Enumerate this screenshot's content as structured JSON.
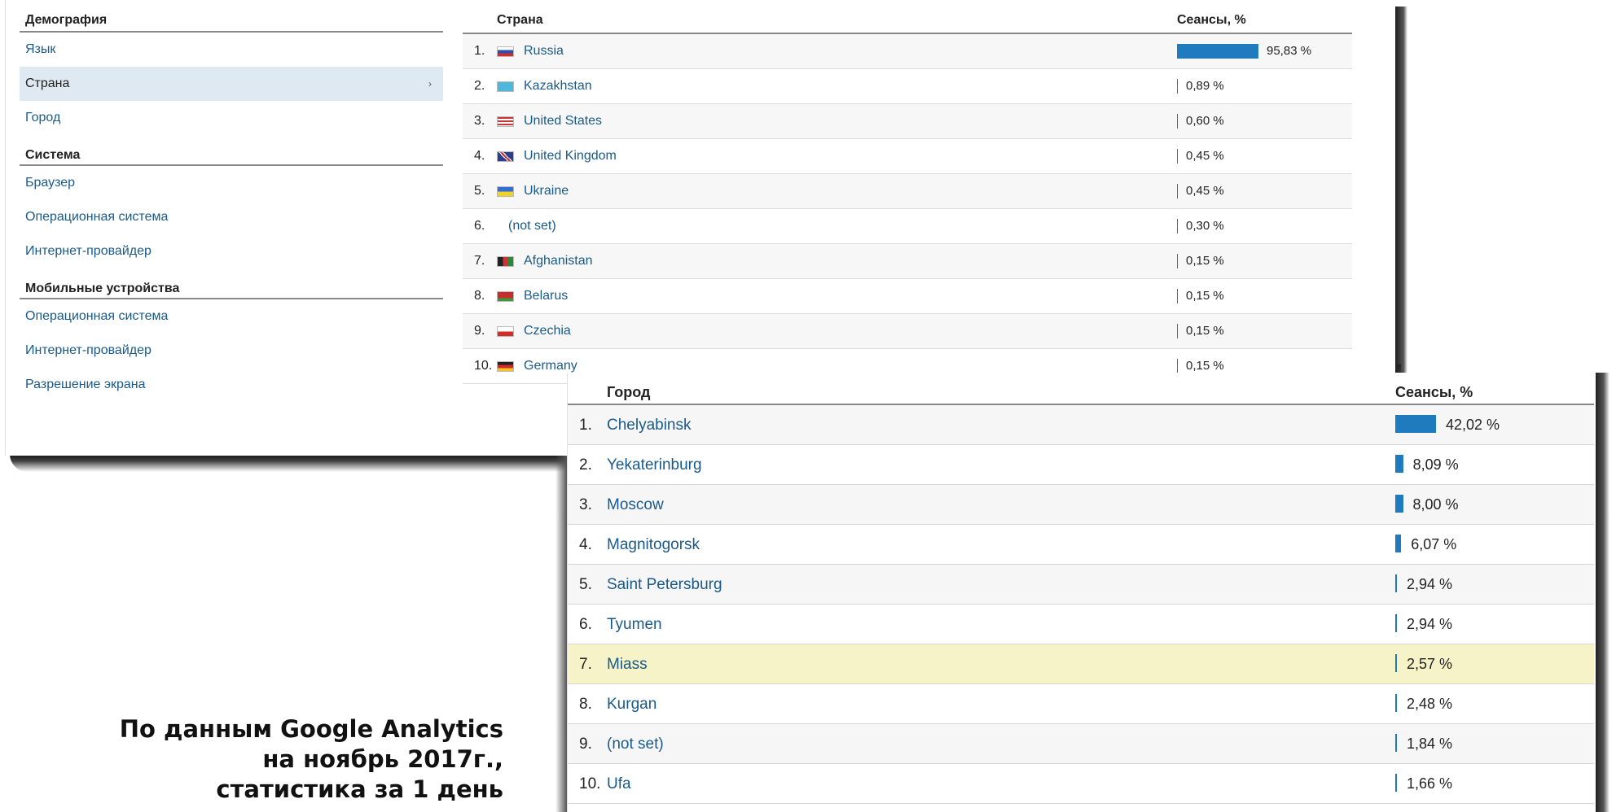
{
  "sidebar": {
    "sections": [
      {
        "title": "Демография",
        "items": [
          "Язык",
          "Страна",
          "Город"
        ],
        "active": 1
      },
      {
        "title": "Система",
        "items": [
          "Браузер",
          "Операционная система",
          "Интернет-провайдер"
        ]
      },
      {
        "title": "Мобильные устройства",
        "items": [
          "Операционная система",
          "Интернет-провайдер",
          "Разрешение экрана"
        ]
      }
    ]
  },
  "country_table": {
    "headers": {
      "dimension": "Страна",
      "metric": "Сеансы, %"
    },
    "rows": [
      {
        "rank": "1.",
        "name": "Russia",
        "flag": "russia-flag-icon",
        "value": "95,83 %",
        "share": 95.83
      },
      {
        "rank": "2.",
        "name": "Kazakhstan",
        "flag": "kazakhstan-flag-icon",
        "value": "0,89 %",
        "share": 0.89
      },
      {
        "rank": "3.",
        "name": "United States",
        "flag": "united-states-flag-icon",
        "value": "0,60 %",
        "share": 0.6
      },
      {
        "rank": "4.",
        "name": "United Kingdom",
        "flag": "united-kingdom-flag-icon",
        "value": "0,45 %",
        "share": 0.45
      },
      {
        "rank": "5.",
        "name": "Ukraine",
        "flag": "ukraine-flag-icon",
        "value": "0,45 %",
        "share": 0.45
      },
      {
        "rank": "6.",
        "name": "(not set)",
        "flag": "",
        "value": "0,30 %",
        "share": 0.3
      },
      {
        "rank": "7.",
        "name": "Afghanistan",
        "flag": "afghanistan-flag-icon",
        "value": "0,15 %",
        "share": 0.15
      },
      {
        "rank": "8.",
        "name": "Belarus",
        "flag": "belarus-flag-icon",
        "value": "0,15 %",
        "share": 0.15
      },
      {
        "rank": "9.",
        "name": "Czechia",
        "flag": "czechia-flag-icon",
        "value": "0,15 %",
        "share": 0.15
      },
      {
        "rank": "10.",
        "name": "Germany",
        "flag": "germany-flag-icon",
        "value": "0,15 %",
        "share": 0.15
      }
    ]
  },
  "city_table": {
    "headers": {
      "dimension": "Город",
      "metric": "Сеансы, %"
    },
    "rows": [
      {
        "rank": "1.",
        "name": "Chelyabinsk",
        "value": "42,02 %",
        "share": 42.02
      },
      {
        "rank": "2.",
        "name": "Yekaterinburg",
        "value": "8,09 %",
        "share": 8.09
      },
      {
        "rank": "3.",
        "name": "Moscow",
        "value": "8,00 %",
        "share": 8.0
      },
      {
        "rank": "4.",
        "name": "Magnitogorsk",
        "value": "6,07 %",
        "share": 6.07
      },
      {
        "rank": "5.",
        "name": "Saint Petersburg",
        "value": "2,94 %",
        "share": 2.94
      },
      {
        "rank": "6.",
        "name": "Tyumen",
        "value": "2,94 %",
        "share": 2.94
      },
      {
        "rank": "7.",
        "name": "Miass",
        "value": "2,57 %",
        "share": 2.57,
        "highlighted": true
      },
      {
        "rank": "8.",
        "name": "Kurgan",
        "value": "2,48 %",
        "share": 2.48
      },
      {
        "rank": "9.",
        "name": "(not set)",
        "value": "1,84 %",
        "share": 1.84
      },
      {
        "rank": "10.",
        "name": "Ufa",
        "value": "1,66 %",
        "share": 1.66
      }
    ]
  },
  "caption": {
    "line1": "По данным Google Analytics",
    "line2": "на ноябрь 2017г.,",
    "line3": "статистика за 1 день"
  },
  "colors": {
    "bar": "#1f7bbd",
    "link": "#1a5a8a",
    "active_bg": "#dfe9f2",
    "highlight_bg": "#f7f3c9"
  }
}
